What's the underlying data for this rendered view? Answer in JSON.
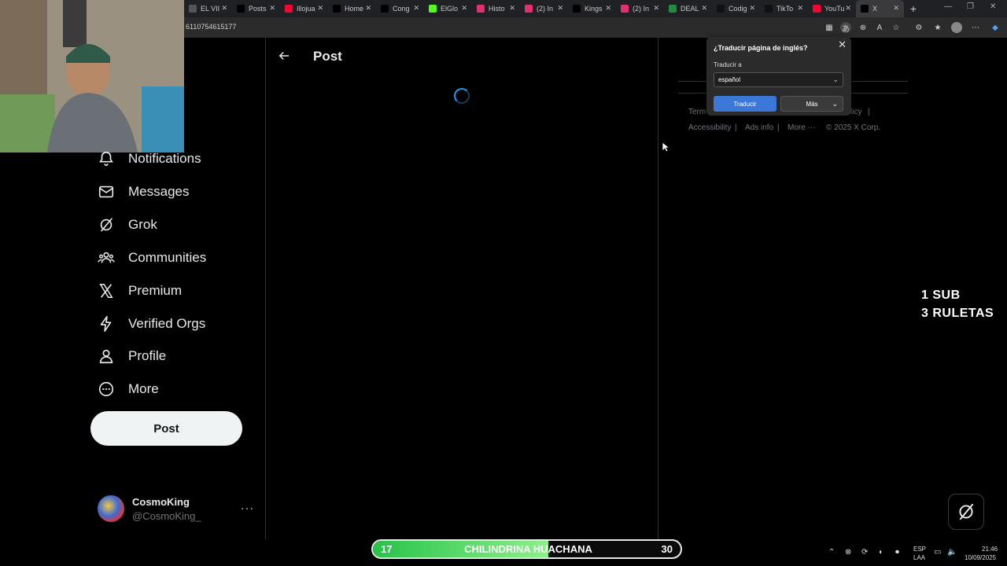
{
  "browser": {
    "tabs": [
      {
        "label": "EL VII",
        "icon": "video-icon",
        "color": "#555555"
      },
      {
        "label": "Posts",
        "icon": "x-logo-icon",
        "color": "#000000"
      },
      {
        "label": "Illojua",
        "icon": "youtube-icon",
        "color": "#ff0033"
      },
      {
        "label": "Home",
        "icon": "x-logo-icon",
        "color": "#000000"
      },
      {
        "label": "Cong",
        "icon": "x-logo-icon",
        "color": "#000000"
      },
      {
        "label": "ElGlo",
        "icon": "kick-icon",
        "color": "#53fc18"
      },
      {
        "label": "Histo",
        "icon": "instagram-icon",
        "color": "#e1306c"
      },
      {
        "label": "(2) In",
        "icon": "instagram-icon",
        "color": "#e1306c"
      },
      {
        "label": "Kings",
        "icon": "x-logo-icon",
        "color": "#000000"
      },
      {
        "label": "(2) In",
        "icon": "instagram-icon",
        "color": "#e1306c"
      },
      {
        "label": "DEAL",
        "icon": "spreadsheet-icon",
        "color": "#1e8e3e"
      },
      {
        "label": "Codig",
        "icon": "tiktok-icon",
        "color": "#111111"
      },
      {
        "label": "TikTo",
        "icon": "tiktok-icon",
        "color": "#111111"
      },
      {
        "label": "YouTu",
        "icon": "youtube-icon",
        "color": "#ff0033"
      },
      {
        "label": "X",
        "icon": "x-logo-icon",
        "color": "#000000"
      }
    ],
    "url": "6110754615177"
  },
  "nav": {
    "items": [
      {
        "label": "Notifications",
        "icon": "bell-icon"
      },
      {
        "label": "Messages",
        "icon": "envelope-icon"
      },
      {
        "label": "Grok",
        "icon": "grok-icon"
      },
      {
        "label": "Communities",
        "icon": "communities-icon"
      },
      {
        "label": "Premium",
        "icon": "x-logo-icon"
      },
      {
        "label": "Verified Orgs",
        "icon": "lightning-icon"
      },
      {
        "label": "Profile",
        "icon": "person-icon"
      },
      {
        "label": "More",
        "icon": "more-circle-icon"
      }
    ],
    "post_button": "Post"
  },
  "account": {
    "name": "CosmoKing",
    "handle": "@CosmoKing_",
    "more": "···"
  },
  "main": {
    "title": "Post"
  },
  "footer": {
    "links": [
      "Term",
      "licy",
      "|",
      "Accessibility",
      "|",
      "Ads info",
      "|",
      "More ···",
      "© 2025 X Corp."
    ]
  },
  "translate": {
    "title": "¿Traducir página de inglés?",
    "target_label": "Traducir a",
    "selected_language": "español",
    "translate_button": "Traducir",
    "more_button": "Más"
  },
  "stream_overlay": {
    "lines": [
      "1 SUB",
      "3 RULETAS"
    ],
    "goal": {
      "current": "17",
      "title": "CHILINDRINA HUACHANA",
      "target": "30",
      "progress_fraction": 0.57,
      "fill_color": "#28c24a"
    }
  },
  "taskbar": {
    "lang": "ESP",
    "region": "LAA",
    "time": "21:46",
    "date": "10/09/2025"
  }
}
